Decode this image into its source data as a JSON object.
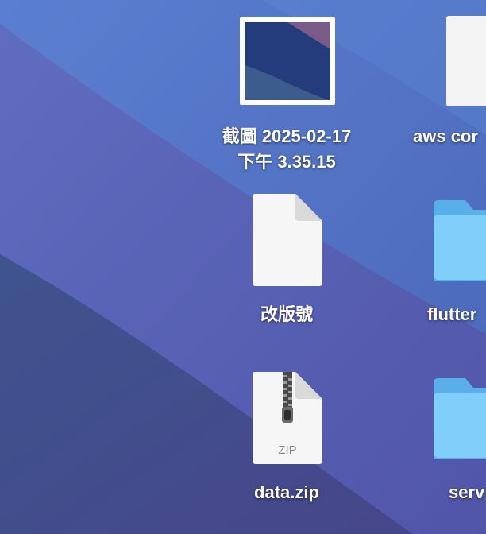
{
  "desktop": {
    "items": [
      {
        "type": "screenshot-thumbnail",
        "label_line1": "截圖 2025-02-17",
        "label_line2": "下午 3.35.15"
      },
      {
        "type": "document",
        "label": "aws cor"
      },
      {
        "type": "document",
        "label": "改版號"
      },
      {
        "type": "folder",
        "label": "flutter"
      },
      {
        "type": "zip-archive",
        "label": "data.zip",
        "badge": "ZIP"
      },
      {
        "type": "folder",
        "label": "serv"
      }
    ]
  },
  "colors": {
    "wallpaper_top": "#4f78c6",
    "wallpaper_mid": "#5560b0",
    "wallpaper_bottom": "#3a4f8e",
    "folder_body": "#7fcdf8",
    "folder_tab": "#58aeea",
    "document": "#f5f5f5"
  }
}
